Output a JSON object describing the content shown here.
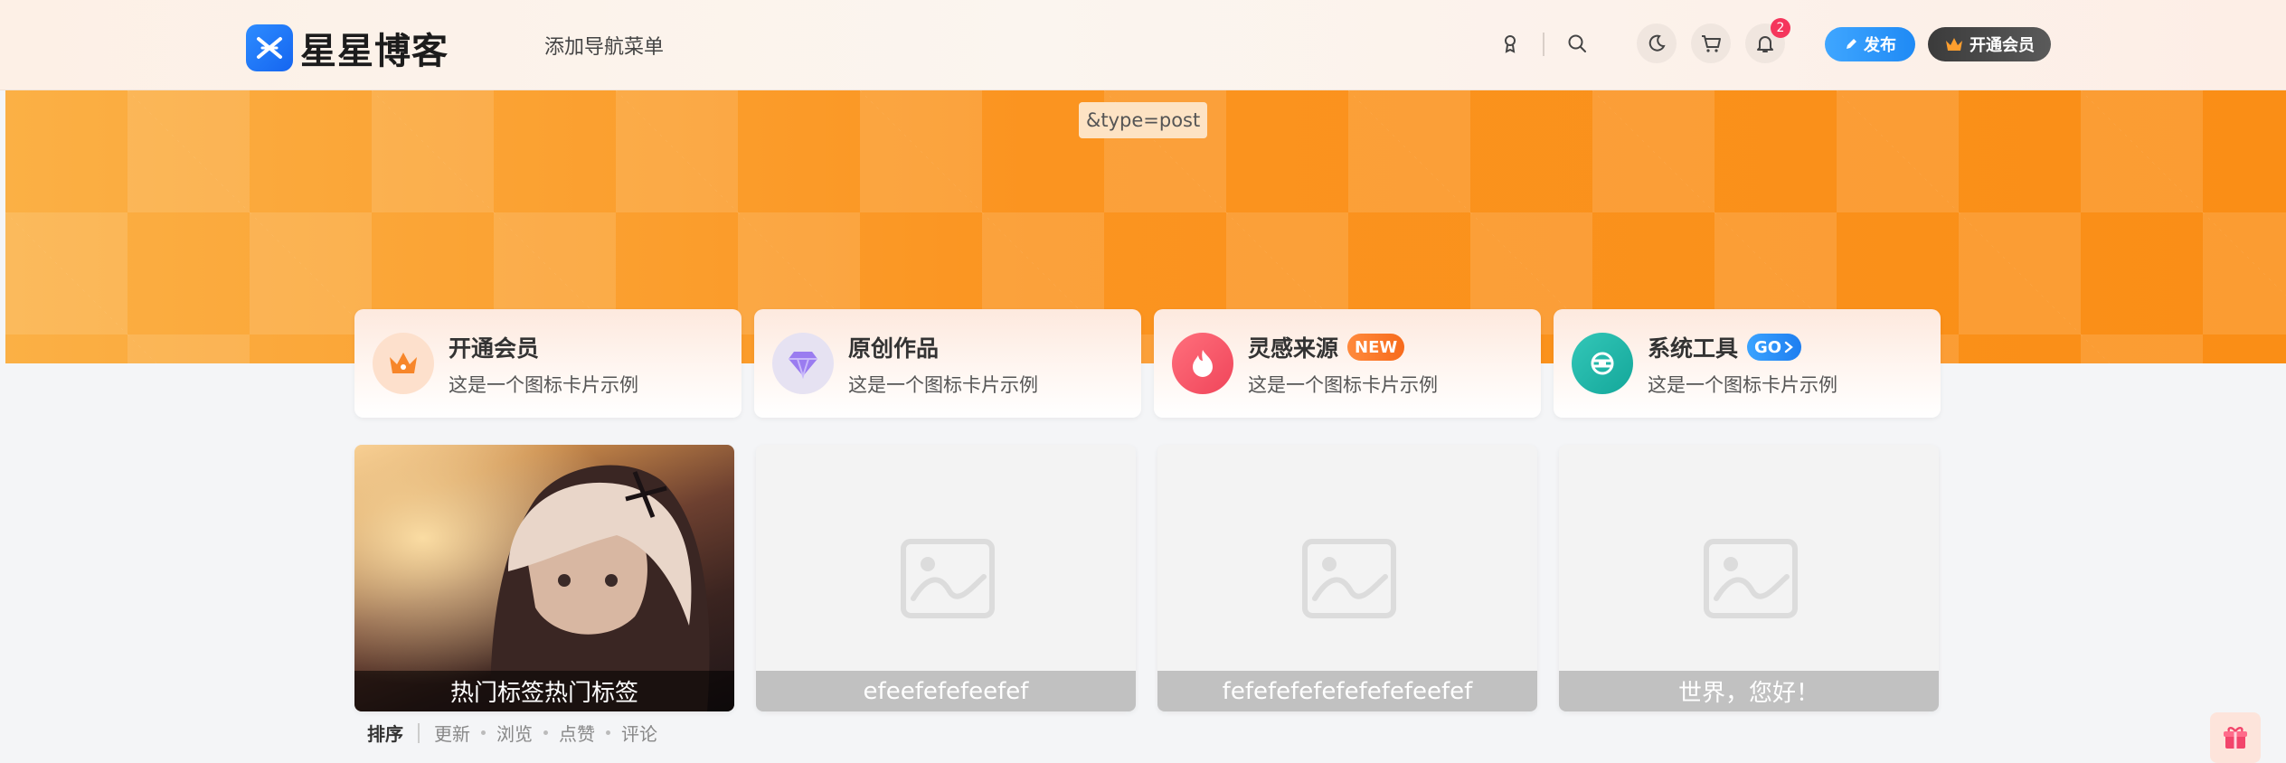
{
  "header": {
    "logo_text": "星星博客",
    "nav_add": "添加导航菜单",
    "notification_count": "2",
    "publish_label": "发布",
    "vip_label": "开通会员"
  },
  "banner": {
    "type_tag": "&type=post"
  },
  "icon_cards": [
    {
      "title": "开通会员",
      "subtitle": "这是一个图标卡片示例",
      "icon": "crown-icon",
      "badge": ""
    },
    {
      "title": "原创作品",
      "subtitle": "这是一个图标卡片示例",
      "icon": "diamond-icon",
      "badge": ""
    },
    {
      "title": "灵感来源",
      "subtitle": "这是一个图标卡片示例",
      "icon": "flame-icon",
      "badge": "NEW"
    },
    {
      "title": "系统工具",
      "subtitle": "这是一个图标卡片示例",
      "icon": "tool-icon",
      "badge": "GO"
    }
  ],
  "posts": [
    {
      "caption": "热门标签热门标签",
      "has_image": true
    },
    {
      "caption": "efeefefefeefef",
      "has_image": false
    },
    {
      "caption": "fefefefefefefefefeefef",
      "has_image": false
    },
    {
      "caption": "世界，您好！",
      "has_image": false
    }
  ],
  "sort": {
    "label": "排序",
    "options": [
      "更新",
      "浏览",
      "点赞",
      "评论"
    ]
  },
  "colors": {
    "banner": "#fb9a1e",
    "accent_blue": "#1f8af5",
    "badge_red": "#f5365c"
  }
}
